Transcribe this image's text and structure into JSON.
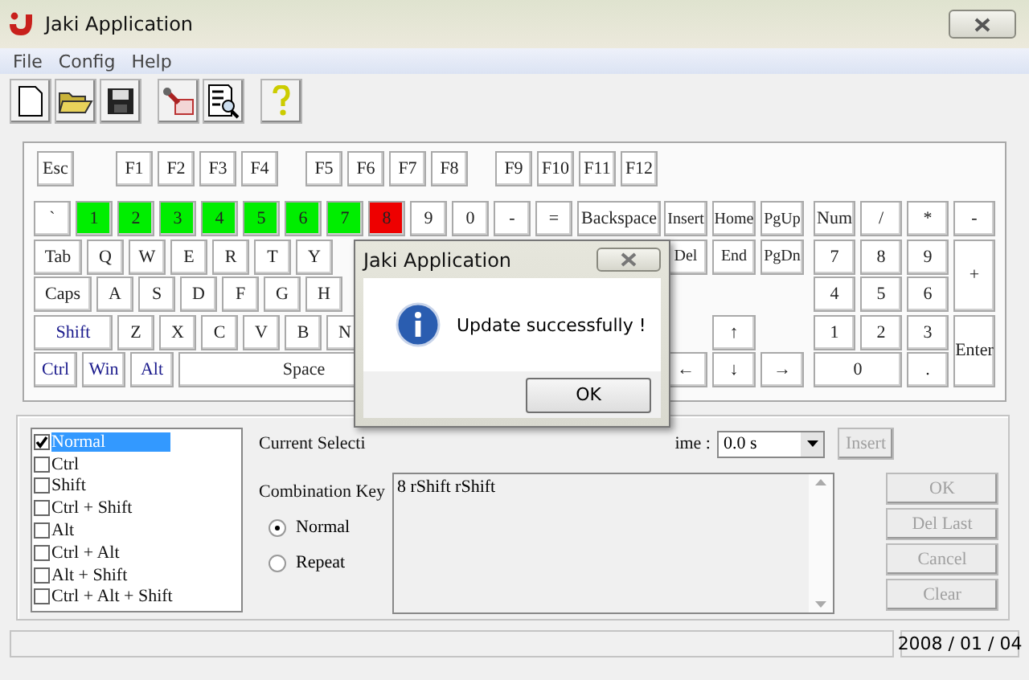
{
  "window": {
    "title": "Jaki Application"
  },
  "menu": [
    "File",
    "Config",
    "Help"
  ],
  "keyboard": {
    "function_groups": [
      [
        "Esc"
      ],
      [
        "F1",
        "F2",
        "F3",
        "F4"
      ],
      [
        "F5",
        "F6",
        "F7",
        "F8"
      ],
      [
        "F9",
        "F10",
        "F11",
        "F12"
      ]
    ],
    "rows": [
      {
        "keys": [
          {
            "label": "`",
            "kind": "key"
          },
          {
            "label": "1",
            "kind": "key",
            "color": "#00ee00"
          },
          {
            "label": "2",
            "kind": "key",
            "color": "#00ee00"
          },
          {
            "label": "3",
            "kind": "key",
            "color": "#00ee00"
          },
          {
            "label": "4",
            "kind": "key",
            "color": "#00ee00"
          },
          {
            "label": "5",
            "kind": "key",
            "color": "#00ee00"
          },
          {
            "label": "6",
            "kind": "key",
            "color": "#00ee00"
          },
          {
            "label": "7",
            "kind": "key",
            "color": "#00ee00"
          },
          {
            "label": "8",
            "kind": "key",
            "color": "#ee0000"
          },
          {
            "label": "9",
            "kind": "key"
          },
          {
            "label": "0",
            "kind": "key"
          },
          {
            "label": "-",
            "kind": "key"
          },
          {
            "label": "=",
            "kind": "key"
          },
          {
            "label": "Backspace",
            "kind": "backspace"
          }
        ]
      },
      {
        "keys": [
          {
            "label": "Tab",
            "kind": "tab"
          },
          {
            "label": "Q",
            "kind": "key"
          },
          {
            "label": "W",
            "kind": "key"
          },
          {
            "label": "E",
            "kind": "key"
          },
          {
            "label": "R",
            "kind": "key"
          },
          {
            "label": "T",
            "kind": "key"
          },
          {
            "label": "Y",
            "kind": "key"
          }
        ]
      },
      {
        "keys": [
          {
            "label": "Caps",
            "kind": "caps"
          },
          {
            "label": "A",
            "kind": "key"
          },
          {
            "label": "S",
            "kind": "key"
          },
          {
            "label": "D",
            "kind": "key"
          },
          {
            "label": "F",
            "kind": "key"
          },
          {
            "label": "G",
            "kind": "key"
          },
          {
            "label": "H",
            "kind": "key"
          }
        ]
      },
      {
        "keys": [
          {
            "label": "Shift",
            "kind": "shift"
          },
          {
            "label": "Z",
            "kind": "key"
          },
          {
            "label": "X",
            "kind": "key"
          },
          {
            "label": "C",
            "kind": "key"
          },
          {
            "label": "V",
            "kind": "key"
          },
          {
            "label": "B",
            "kind": "key"
          },
          {
            "label": "N",
            "kind": "key"
          }
        ]
      },
      {
        "keys": [
          {
            "label": "Ctrl",
            "kind": "mod"
          },
          {
            "label": "Win",
            "kind": "mod"
          },
          {
            "label": "Alt",
            "kind": "mod"
          },
          {
            "label": "Space",
            "kind": "space"
          }
        ]
      }
    ],
    "nav": [
      "Insert",
      "Home",
      "PgUp",
      "Del",
      "End",
      "PgDn"
    ],
    "arrows": [
      "↑",
      "←",
      "↓",
      "→"
    ],
    "numpad": [
      {
        "label": "Num",
        "kind": "key"
      },
      {
        "label": "/",
        "kind": "key"
      },
      {
        "label": "*",
        "kind": "key"
      },
      {
        "label": "-",
        "kind": "key"
      },
      {
        "label": "7",
        "kind": "key"
      },
      {
        "label": "8",
        "kind": "key"
      },
      {
        "label": "9",
        "kind": "key"
      },
      {
        "label": "+",
        "kind": "tall"
      },
      {
        "label": "4",
        "kind": "key"
      },
      {
        "label": "5",
        "kind": "key"
      },
      {
        "label": "6",
        "kind": "key"
      },
      {
        "label": "1",
        "kind": "key"
      },
      {
        "label": "2",
        "kind": "key"
      },
      {
        "label": "3",
        "kind": "key"
      },
      {
        "label": "Enter",
        "kind": "tall"
      },
      {
        "label": "0",
        "kind": "wide"
      },
      {
        "label": ".",
        "kind": "key"
      }
    ]
  },
  "modes": [
    {
      "label": "Normal",
      "checked": true,
      "selected": true
    },
    {
      "label": "Ctrl",
      "checked": false,
      "selected": false
    },
    {
      "label": "Shift",
      "checked": false,
      "selected": false
    },
    {
      "label": "Ctrl + Shift",
      "checked": false,
      "selected": false
    },
    {
      "label": "Alt",
      "checked": false,
      "selected": false
    },
    {
      "label": "Ctrl + Alt",
      "checked": false,
      "selected": false
    },
    {
      "label": "Alt + Shift",
      "checked": false,
      "selected": false
    },
    {
      "label": "Ctrl + Alt + Shift",
      "checked": false,
      "selected": false
    }
  ],
  "current_selection_label": "Current Selecti",
  "time_label": "ime :",
  "time_value": "0.0 s",
  "insert_button": {
    "label": "Insert",
    "disabled": true
  },
  "combination_label": "Combination Key",
  "combination_value": "8 rShift rShift",
  "repeat_options": [
    {
      "label": "Normal",
      "selected": true
    },
    {
      "label": "Repeat",
      "selected": false
    }
  ],
  "actions": [
    {
      "label": "OK",
      "disabled": true
    },
    {
      "label": "Del Last",
      "disabled": true
    },
    {
      "label": "Cancel",
      "disabled": true
    },
    {
      "label": "Clear",
      "disabled": true
    }
  ],
  "status_bar": {
    "date": "2008 / 01 / 04"
  },
  "dialog": {
    "title": "Jaki Application",
    "message": "Update successfully !",
    "button": "OK"
  }
}
